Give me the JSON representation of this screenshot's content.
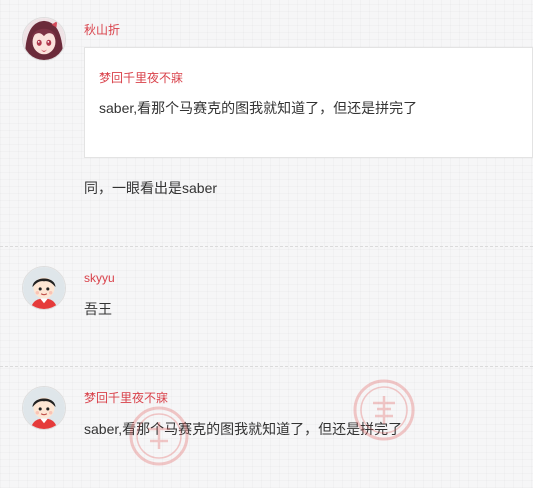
{
  "comments": [
    {
      "author": "秋山折",
      "avatar_icon": "anime-girl-avatar-icon",
      "quote": {
        "author": "梦回千里夜不寐",
        "text": "saber,看那个马赛克的图我就知道了，但还是拼完了"
      },
      "text": "同，一眼看出是saber"
    },
    {
      "author": "skyyu",
      "avatar_icon": "default-boy-avatar-icon",
      "text": "吾王"
    },
    {
      "author": "梦回千里夜不寐",
      "avatar_icon": "default-boy-avatar-icon",
      "text": "saber,看那个马赛克的图我就知道了，但还是拼完了"
    }
  ],
  "colors": {
    "author": "#d9414a",
    "text": "#333333",
    "background": "#f6f6f7",
    "stamp": "#e04848"
  },
  "decorations": [
    "seal-stamp-icon",
    "seal-stamp-icon"
  ]
}
